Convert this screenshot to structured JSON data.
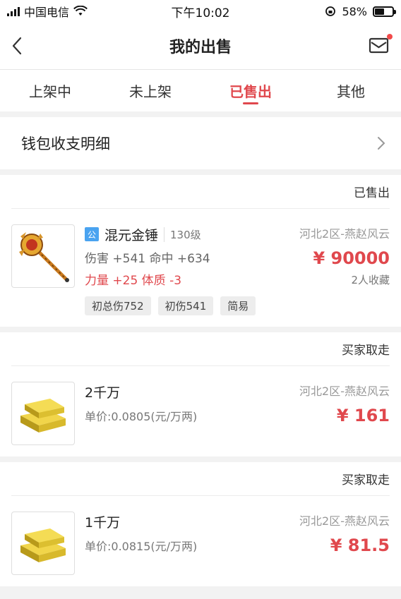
{
  "status_bar": {
    "carrier": "中国电信",
    "time": "下午10:02",
    "battery": "58%",
    "battery_level": 0.58
  },
  "header": {
    "title": "我的出售"
  },
  "tabs": [
    {
      "label": "上架中",
      "active": false
    },
    {
      "label": "未上架",
      "active": false
    },
    {
      "label": "已售出",
      "active": true
    },
    {
      "label": "其他",
      "active": false
    }
  ],
  "wallet": {
    "label": "钱包收支明细"
  },
  "orders": [
    {
      "status": "已售出",
      "badge": "公",
      "name": "混元金锤",
      "level": "130级",
      "attr1": "伤害 +541 命中 +634",
      "attr2": "力量 +25 体质 -3",
      "tags": [
        "初总伤752",
        "初伤541",
        "简易"
      ],
      "server": "河北2区-燕赵风云",
      "price": "¥ 90000",
      "favorites": "2人收藏"
    },
    {
      "status": "买家取走",
      "name": "2千万",
      "unit_price": "单价:0.0805(元/万两)",
      "server": "河北2区-燕赵风云",
      "price": "¥ 161"
    },
    {
      "status": "买家取走",
      "name": "1千万",
      "unit_price": "单价:0.0815(元/万两)",
      "server": "河北2区-燕赵风云",
      "price": "¥ 81.5"
    }
  ],
  "colors": {
    "accent": "#e0484d",
    "badge": "#4aa3f0",
    "notify_dot": "#f24a4a"
  }
}
